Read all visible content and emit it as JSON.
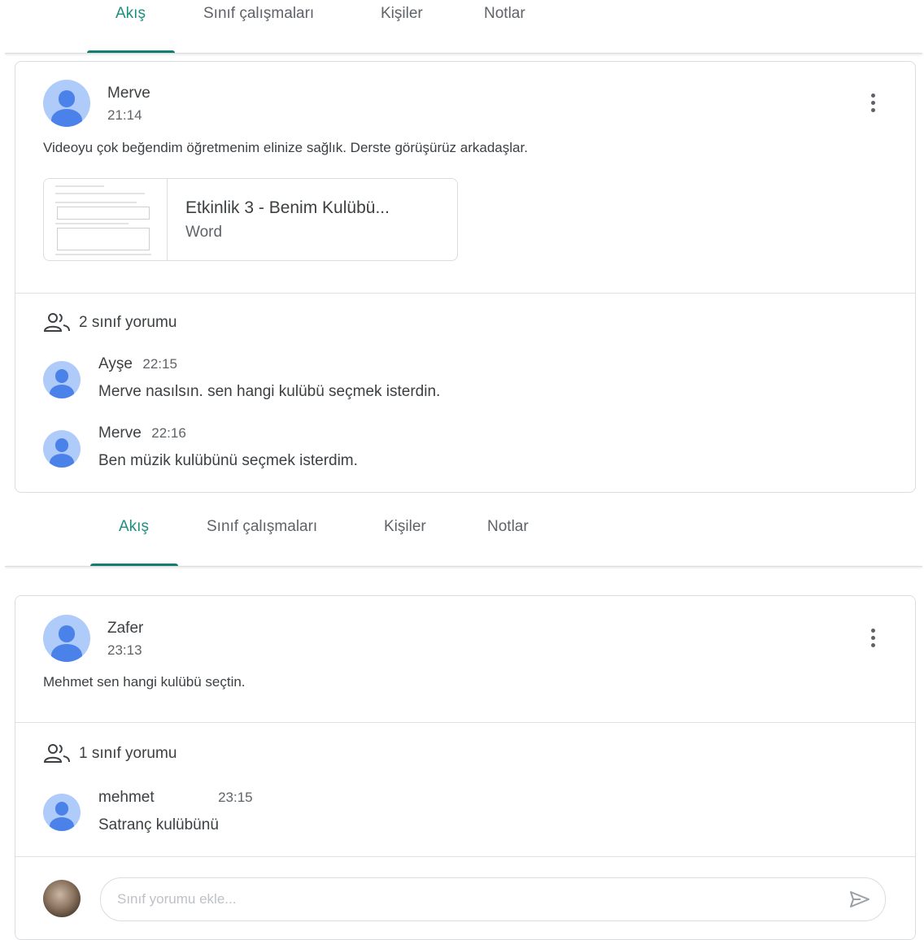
{
  "tabs": [
    "Akış",
    "Sınıf çalışmaları",
    "Kişiler",
    "Notlar"
  ],
  "posts": [
    {
      "author": "Merve",
      "time": "21:14",
      "text": "Videoyu çok beğendim öğretmenim elinize sağlık. Derste görüşürüz arkadaşlar.",
      "attachment": {
        "title": "Etkinlik 3 - Benim Kulübü...",
        "type": "Word"
      },
      "comment_count": "2 sınıf yorumu",
      "comments": [
        {
          "author": "Ayşe",
          "time": "22:15",
          "text": "Merve nasılsın. sen hangi kulübü seçmek isterdin."
        },
        {
          "author": "Merve",
          "time": "22:16",
          "text": "Ben müzik kulübünü seçmek isterdim."
        }
      ]
    },
    {
      "author": "Zafer",
      "time": "23:13",
      "text": "Mehmet sen hangi kulübü seçtin.",
      "comment_count": "1 sınıf yorumu",
      "comments": [
        {
          "author": "mehmet",
          "time": "23:15",
          "text": "Satranç kulübünü"
        }
      ]
    }
  ],
  "comment_input": {
    "placeholder": "Sınıf yorumu ekle...",
    "value": ""
  },
  "icons": {
    "more": "more-vert-icon",
    "people": "people-icon",
    "send": "send-icon",
    "avatar": "default-avatar-icon"
  },
  "colors": {
    "accent": "#1e8e7e",
    "avatar_bg": "#aecbfa",
    "avatar_fg": "#4b82e9"
  }
}
